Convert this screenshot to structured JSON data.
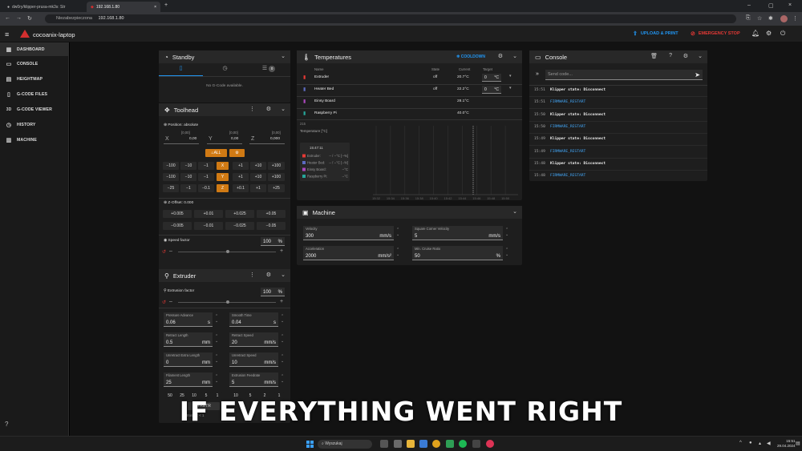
{
  "browser": {
    "tabs": [
      {
        "label": "dw0ry/klipper-prusa-mk3s: Str"
      },
      {
        "label": "192.168.1.80"
      }
    ],
    "url": "192.168.1.80",
    "secure_label": "Niezabezpieczona"
  },
  "app": {
    "name": "cocoanix-laptop",
    "upload_label": "UPLOAD & PRINT",
    "emergency_label": "EMERGENCY STOP",
    "brand_color": "#d32f2f",
    "accent": "#2196f3"
  },
  "sidebar": {
    "items": [
      {
        "label": "DASHBOARD",
        "icon": "dashboard-icon"
      },
      {
        "label": "CONSOLE",
        "icon": "console-icon"
      },
      {
        "label": "HEIGHTMAP",
        "icon": "heightmap-icon"
      },
      {
        "label": "G-CODE FILES",
        "icon": "file-icon"
      },
      {
        "label": "G-CODE VIEWER",
        "icon": "3d-icon"
      },
      {
        "label": "HISTORY",
        "icon": "history-icon"
      },
      {
        "label": "MACHINE",
        "icon": "machine-icon"
      }
    ]
  },
  "standby": {
    "title": "Standby",
    "queue_count": "0",
    "empty_text": "No G-Code available."
  },
  "toolhead": {
    "title": "Toolhead",
    "position_label": "Position: absolute",
    "axes": [
      {
        "name": "X",
        "dim": "",
        "value": "0,00"
      },
      {
        "name": "Y",
        "dim": "[0,00]",
        "value": "0,00"
      },
      {
        "name": "Z",
        "dim": "[0,00]",
        "value": "0,000"
      }
    ],
    "x_dim": "[0,00]",
    "home_all": "ALL",
    "jog_rows": [
      {
        "cells": [
          "−100",
          "−10",
          "−1",
          "X",
          "+1",
          "+10",
          "+100"
        ]
      },
      {
        "cells": [
          "−100",
          "−10",
          "−1",
          "Y",
          "+1",
          "+10",
          "+100"
        ]
      },
      {
        "cells": [
          "−25",
          "−1",
          "−0.1",
          "Z",
          "+0.1",
          "+1",
          "+25"
        ]
      }
    ],
    "zoffset_label": "Z-Offset: 0.000",
    "zoffset_up": [
      "+0.005",
      "+0.01",
      "+0.025",
      "+0.05"
    ],
    "zoffset_down": [
      "−0.005",
      "−0.01",
      "−0.025",
      "−0.05"
    ],
    "speed_label": "Speed factor",
    "speed_value": "100",
    "speed_unit": "%"
  },
  "extruder": {
    "title": "Extruder",
    "factor_label": "Extrusion factor",
    "factor_value": "100",
    "factor_unit": "%",
    "fields": [
      {
        "label": "Pressure Advance",
        "value": "0.06",
        "unit": "s"
      },
      {
        "label": "Smooth Time",
        "value": "0.04",
        "unit": "s"
      },
      {
        "label": "Retract Length",
        "value": "0.5",
        "unit": "mm"
      },
      {
        "label": "Retract Speed",
        "value": "20",
        "unit": "mm/s"
      },
      {
        "label": "Unretract Extra Length",
        "value": "0",
        "unit": "mm"
      },
      {
        "label": "Unretract Speed",
        "value": "10",
        "unit": "mm/s"
      },
      {
        "label": "Filament Length",
        "value": "25",
        "unit": "mm"
      },
      {
        "label": "Extrusion Feedrate",
        "value": "5",
        "unit": "mm/s"
      }
    ],
    "length_presets": [
      "50",
      "25",
      "10",
      "5",
      "1"
    ],
    "feed_presets": [
      "10",
      "5",
      "2",
      "1"
    ],
    "retract_label": "RETR",
    "extrusion_text": "Extrusion: < 1"
  },
  "temperatures": {
    "title": "Temperatures",
    "cooldown_label": "COOLDOWN",
    "headers": {
      "name": "Name",
      "state": "State",
      "current": "Current",
      "target": "Target"
    },
    "rows": [
      {
        "name": "Extruder",
        "state": "off",
        "current": "20.7°C",
        "target": "0",
        "unit": "°C",
        "icon": "extruder-icon",
        "color": "#e53935"
      },
      {
        "name": "Heater Bed",
        "state": "off",
        "current": "22.2°C",
        "target": "0",
        "unit": "°C",
        "icon": "bed-icon",
        "color": "#5c6bc0"
      },
      {
        "name": "Einsy Board",
        "state": "",
        "current": "28.1°C",
        "target": "",
        "unit": "",
        "icon": "thermometer-icon",
        "color": "#ab47bc"
      },
      {
        "name": "Raspberry Pi",
        "state": "",
        "current": "40.0°C",
        "target": "",
        "unit": "",
        "icon": "thermometer-icon",
        "color": "#26a69a"
      }
    ]
  },
  "chart_data": {
    "type": "line",
    "ylabel": "Temperature [°C]",
    "ymax_label": "215",
    "x": [
      "15:32",
      "15:34",
      "15:36",
      "15:38",
      "15:40",
      "15:42",
      "15:44",
      "15:46",
      "15:48",
      "15:50"
    ],
    "tooltip": {
      "time": "15:47:11",
      "rows": [
        {
          "name": "Extruder:",
          "value": "-- / --°C [--%]"
        },
        {
          "name": "Heater Bed:",
          "value": "-- / --°C [--%]"
        },
        {
          "name": "Einsy Board:",
          "value": "--°C"
        },
        {
          "name": "Raspberry Pi:",
          "value": "--°C"
        }
      ]
    },
    "series": []
  },
  "machine": {
    "title": "Machine",
    "fields": [
      {
        "label": "Velocity",
        "value": "300",
        "unit": "mm/s"
      },
      {
        "label": "Square Corner Velocity",
        "value": "5",
        "unit": "mm/s"
      },
      {
        "label": "Acceleration",
        "value": "2000",
        "unit": "mm/s²"
      },
      {
        "label": "Min. Cruise Ratio",
        "value": "50",
        "unit": "%"
      }
    ]
  },
  "console": {
    "title": "Console",
    "placeholder": "Send code...",
    "entries": [
      {
        "time": "15:51",
        "text": "Klipper state: Disconnect",
        "kind": "msg"
      },
      {
        "time": "15:51",
        "text": "FIRMWARE_RESTART",
        "kind": "cmd"
      },
      {
        "time": "15:50",
        "text": "Klipper state: Disconnect",
        "kind": "msg"
      },
      {
        "time": "15:50",
        "text": "FIRMWARE_RESTART",
        "kind": "cmd"
      },
      {
        "time": "15:49",
        "text": "Klipper state: Disconnect",
        "kind": "msg"
      },
      {
        "time": "15:49",
        "text": "FIRMWARE_RESTART",
        "kind": "cmd"
      },
      {
        "time": "15:48",
        "text": "Klipper state: Disconnect",
        "kind": "msg"
      },
      {
        "time": "15:48",
        "text": "FIRMWARE_RESTART",
        "kind": "cmd"
      }
    ]
  },
  "subtitle": "IF EVERYTHING WENT RIGHT",
  "taskbar": {
    "search_placeholder": "Wyszukaj",
    "time": "15:51",
    "date": "29.04.2024"
  }
}
